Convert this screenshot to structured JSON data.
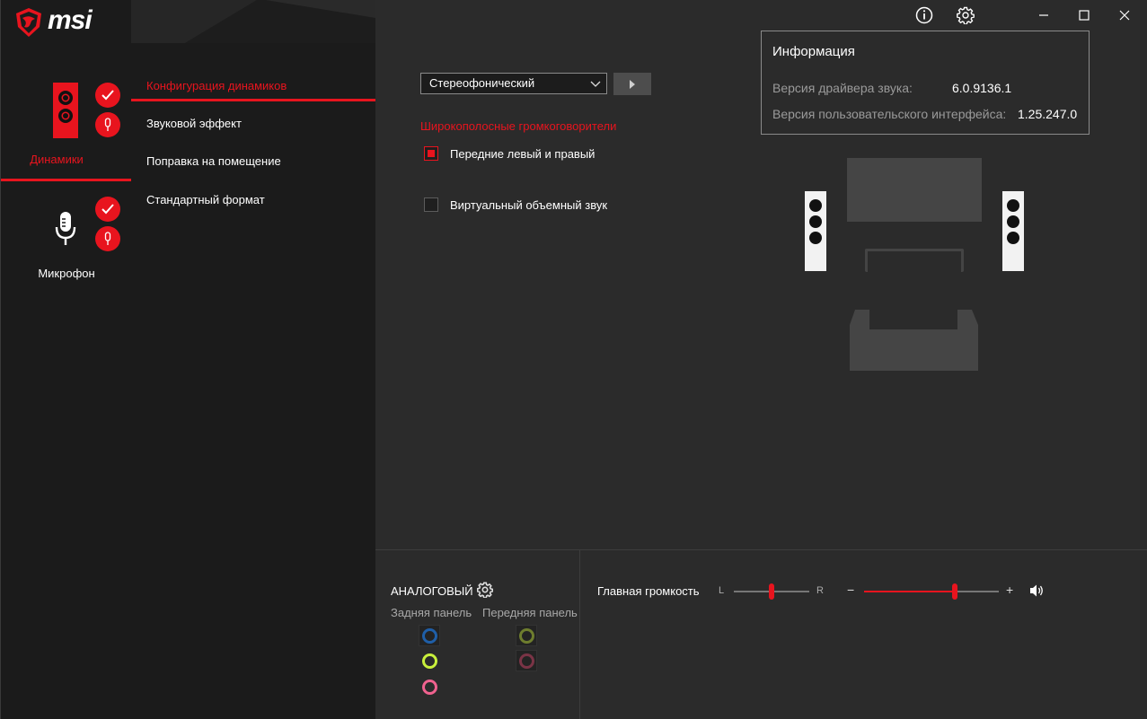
{
  "app": {
    "brand": "msi"
  },
  "devices": [
    {
      "label": "Динамики"
    },
    {
      "label": "Микрофон"
    }
  ],
  "menu": {
    "items": [
      {
        "label": "Конфигурация динамиков",
        "active": true
      },
      {
        "label": "Звуковой эффект"
      },
      {
        "label": "Поправка на помещение"
      },
      {
        "label": "Стандартный формат"
      }
    ]
  },
  "config": {
    "select_value": "Стереофонический",
    "section_title": "Широкополосные громкоговорители",
    "checkboxes": [
      {
        "label": "Передние левый и правый",
        "checked": true
      },
      {
        "label": "Виртуальный объемный звук",
        "checked": false
      }
    ]
  },
  "info": {
    "title": "Информация",
    "driver_label": "Версия драйвера звука:",
    "driver_value": "6.0.9136.1",
    "ui_label": "Версия пользовательского интерфейса:",
    "ui_value": "1.25.247.0"
  },
  "analog": {
    "title": "АНАЛОГОВЫЙ",
    "rear_label": "Задняя панель",
    "front_label": "Передняя панель",
    "jack_colors": {
      "rear_blue": "#1f5fa8",
      "rear_green": "#c9f03c",
      "rear_pink": "#f0628f",
      "front_green": "#6e7d2e",
      "front_pink": "#7a3446"
    }
  },
  "volume": {
    "label": "Главная громкость",
    "balance_left": "L",
    "balance_right": "R",
    "balance_value": 0.5,
    "minus": "−",
    "plus": "+",
    "volume_value": 0.67
  },
  "colors": {
    "accent": "#e8141e"
  }
}
